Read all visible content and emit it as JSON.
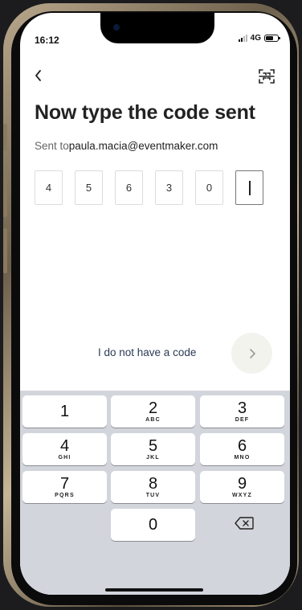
{
  "status_bar": {
    "time": "16:12",
    "network": "4G",
    "icons": [
      "signal-icon",
      "battery-icon"
    ]
  },
  "header": {
    "back_icon": "chevron-left-icon",
    "scan_icon": "qr-scan-icon"
  },
  "title": "Now type the code sent",
  "sent_to": {
    "prefix": "Sent to",
    "email": "paula.macia@eventmaker.com"
  },
  "code_digits": [
    "4",
    "5",
    "6",
    "3",
    "0",
    ""
  ],
  "no_code_link": "I do not have a code",
  "next_icon": "chevron-right-icon",
  "colors": {
    "link": "#2b3a55",
    "next_bg": "#f3f3ee",
    "keyboard_bg": "#d3d5dc"
  },
  "keypad": [
    {
      "num": "1",
      "letters": ""
    },
    {
      "num": "2",
      "letters": "ABC"
    },
    {
      "num": "3",
      "letters": "DEF"
    },
    {
      "num": "4",
      "letters": "GHI"
    },
    {
      "num": "5",
      "letters": "JKL"
    },
    {
      "num": "6",
      "letters": "MNO"
    },
    {
      "num": "7",
      "letters": "PQRS"
    },
    {
      "num": "8",
      "letters": "TUV"
    },
    {
      "num": "9",
      "letters": "WXYZ"
    },
    {
      "num": "0",
      "letters": ""
    }
  ],
  "delete_icon": "backspace-icon"
}
